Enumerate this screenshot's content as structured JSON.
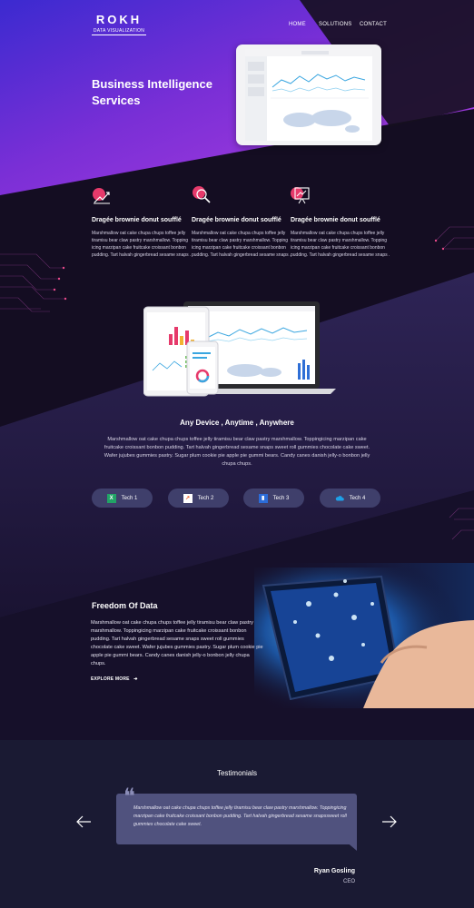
{
  "logo": {
    "text": "ROKH",
    "subtitle": "DATA VISUALIZATION"
  },
  "nav": {
    "items": [
      "HOME",
      "SOLUTIONS",
      "CONTACT"
    ]
  },
  "hero": {
    "title_line1": "Business Intelligence",
    "title_line2": "Services"
  },
  "features": [
    {
      "icon": "growth-chart-icon",
      "title": "Dragée brownie donut soufflé",
      "body": "Marshmallow oat cake chupa chups toffee jelly tiramisu bear claw pastry marshmallow. Topping icing marzipan cake fruitcake croissant bonbon pudding. Tart halvah gingerbread sesame snaps ."
    },
    {
      "icon": "magnifier-icon",
      "title": "Dragée brownie donut soufflé",
      "body": "Marshmallow oat cake chupa chups toffee jelly tiramisu bear claw pastry marshmallow. Topping icing marzipan cake fruitcake croissant bonbon pudding. Tart halvah gingerbread sesame snaps ."
    },
    {
      "icon": "presentation-icon",
      "title": "Dragée brownie donut soufflé",
      "body": "Marshmallow oat cake chupa chups toffee jelly tiramisu bear claw pastry marshmallow. Topping icing marzipan cake fruitcake croissant bonbon pudding. Tart halvah gingerbread sesame snaps ."
    }
  ],
  "devices": {
    "title": "Any Device , Anytime , Anywhere",
    "body": "Marshmallow oat cake chupa chups toffee jelly tiramisu bear claw pastry marshmallow. Toppingicing marzipan cake fruitcake croissant bonbon pudding. Tart halvah gingerbread sesame snaps sweet roll gummies chocolate cake sweet. Wafer jujubes gummies pastry. Sugar plum cookie pie apple pie gummi bears. Candy canes danish jelly-o bonbon jelly chupa chups."
  },
  "techs": [
    {
      "label": "Tech 1",
      "icon": "excel-icon",
      "color": "#21a366"
    },
    {
      "label": "Tech 2",
      "icon": "chart-app-icon",
      "color": "#f25c22"
    },
    {
      "label": "Tech 3",
      "icon": "powerpoint-icon",
      "color": "#2b6cd8"
    },
    {
      "label": "Tech 4",
      "icon": "cloud-icon",
      "color": "#1ea0e8"
    }
  ],
  "freedom": {
    "title": "Freedom Of Data",
    "body": "Marshmallow oat cake chupa chups toffee jelly tiramisu bear claw pastry marshmallow. Toppingicing marzipan cake fruitcake croissant bonbon pudding. Tart halvah gingerbread sesame snaps sweet roll gummies chocolate cake sweet. Wafer jujubes gummies pastry. Sugar plum cookie pie apple pie gummi bears. Candy canes danish jelly-o bonbon jelly chupa chups.",
    "link": "EXPLORE MORE"
  },
  "testimonials": {
    "title": "Testimonials",
    "quote": "Marshmallow oat cake chupa chups toffee jelly tiramisu bear claw pastry marshmallow. Toppingicing marzipan cake fruitcake croissant bonbon pudding. Tart halvah gingerbread sesame snapssweet roll gummies chocolate cake sweet.",
    "author": "Ryan Gosling",
    "role": "CEO"
  },
  "colors": {
    "purple": "#7c2fd6",
    "dark": "#120d1f",
    "pill": "#3f3f6b",
    "accent": "#e63a6b"
  }
}
